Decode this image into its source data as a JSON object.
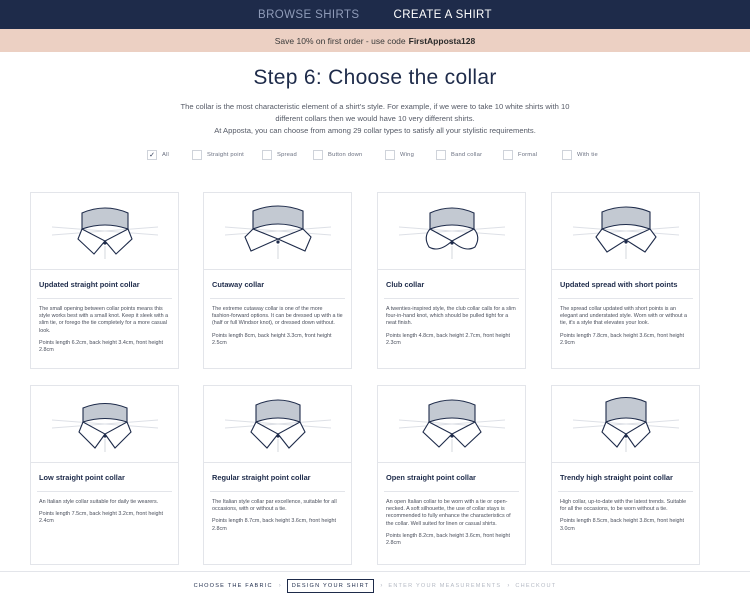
{
  "nav": {
    "browse_label": "BROWSE SHIRTS",
    "create_label": "CREATE A SHIRT"
  },
  "promo": {
    "text": "Save 10% on first order - use code",
    "code": "FirstApposta128"
  },
  "heading": "Step 6: Choose the collar",
  "intro": {
    "line1": "The collar is the most characteristic element of a shirt's style. For example, if we were to take 10 white shirts with 10",
    "line2": "different collars then we would have 10 very different shirts.",
    "line3": "At Apposta, you can choose from among 29 collar types to satisfy all your stylistic requirements."
  },
  "filters": [
    {
      "label": "All",
      "checked": "✓"
    },
    {
      "label": "Straight point",
      "checked": ""
    },
    {
      "label": "Spread",
      "checked": ""
    },
    {
      "label": "Button down",
      "checked": ""
    },
    {
      "label": "Wing",
      "checked": ""
    },
    {
      "label": "Band collar",
      "checked": ""
    },
    {
      "label": "Formal",
      "checked": ""
    },
    {
      "label": "With tie",
      "checked": ""
    }
  ],
  "collars": [
    {
      "title": "Updated straight point collar",
      "desc": "The small opening between collar points means this style works best with a small knot. Keep it sleek with a slim tie, or forego the tie completely for a more casual look.",
      "measure": "Points length 6.2cm, back height 3.4cm, front height 2.8cm",
      "icon": "straight-point-collar-icon"
    },
    {
      "title": "Cutaway collar",
      "desc": "The extreme cutaway collar is one of the more fashion-forward options. It can be dressed up with a tie (half or full Windsor knot), or dressed down without.",
      "measure": "Points length 8cm, back height 3.3cm, front height 2.5cm",
      "icon": "cutaway-collar-icon"
    },
    {
      "title": "Club collar",
      "desc": "A twenties-inspired style, the club collar calls for a slim four-in-hand knot, which should be pulled tight for a neat finish.",
      "measure": "Points length 4.8cm, back height 2.7cm, front height 2.3cm",
      "icon": "club-collar-icon"
    },
    {
      "title": "Updated spread with short points",
      "desc": "The spread collar updated with short points is an elegant and understated style. Worn with or without a tie, it's a style that elevates your look.",
      "measure": "Points length 7.8cm, back height 3.6cm, front height 2.9cm",
      "icon": "spread-collar-icon"
    },
    {
      "title": "Low straight point collar",
      "desc": "An Italian style collar suitable for daily tie wearers.",
      "measure": "Points length 7.5cm, back height 3.2cm, front height 2.4cm",
      "icon": "low-straight-point-collar-icon"
    },
    {
      "title": "Regular straight point collar",
      "desc": "The Italian style collar par excellence, suitable for all occasions, with or without a tie.",
      "measure": "Points length 8.7cm, back height 3.6cm, front height 2.8cm",
      "icon": "regular-straight-point-collar-icon"
    },
    {
      "title": "Open straight point collar",
      "desc": "An open Italian collar to be worn with a tie or open-necked. A soft silhouette, the use of collar stays is recommended to fully enhance the characteristics of the collar. Well suited for linen or casual shirts.",
      "measure": "Points length 8.2cm, back height 3.6cm, front height 2.8cm",
      "icon": "open-straight-point-collar-icon"
    },
    {
      "title": "Trendy high straight point collar",
      "desc": "High collar, up-to-date with the latest trends. Suitable for all the occasions, to be worn without a tie.",
      "measure": "Points length 8.5cm, back height 3.8cm, front height 3.0cm",
      "icon": "high-straight-point-collar-icon"
    }
  ],
  "steps": {
    "fabric": "CHOOSE THE FABRIC",
    "design": "DESIGN YOUR SHIRT",
    "measurements": "ENTER YOUR MEASUREMENTS",
    "checkout": "CHECKOUT",
    "separator": "›"
  },
  "colors": {
    "navy": "#1e2b4a",
    "promo_bg": "#ecd0c3",
    "collar_fill": "#c3c9d2"
  }
}
